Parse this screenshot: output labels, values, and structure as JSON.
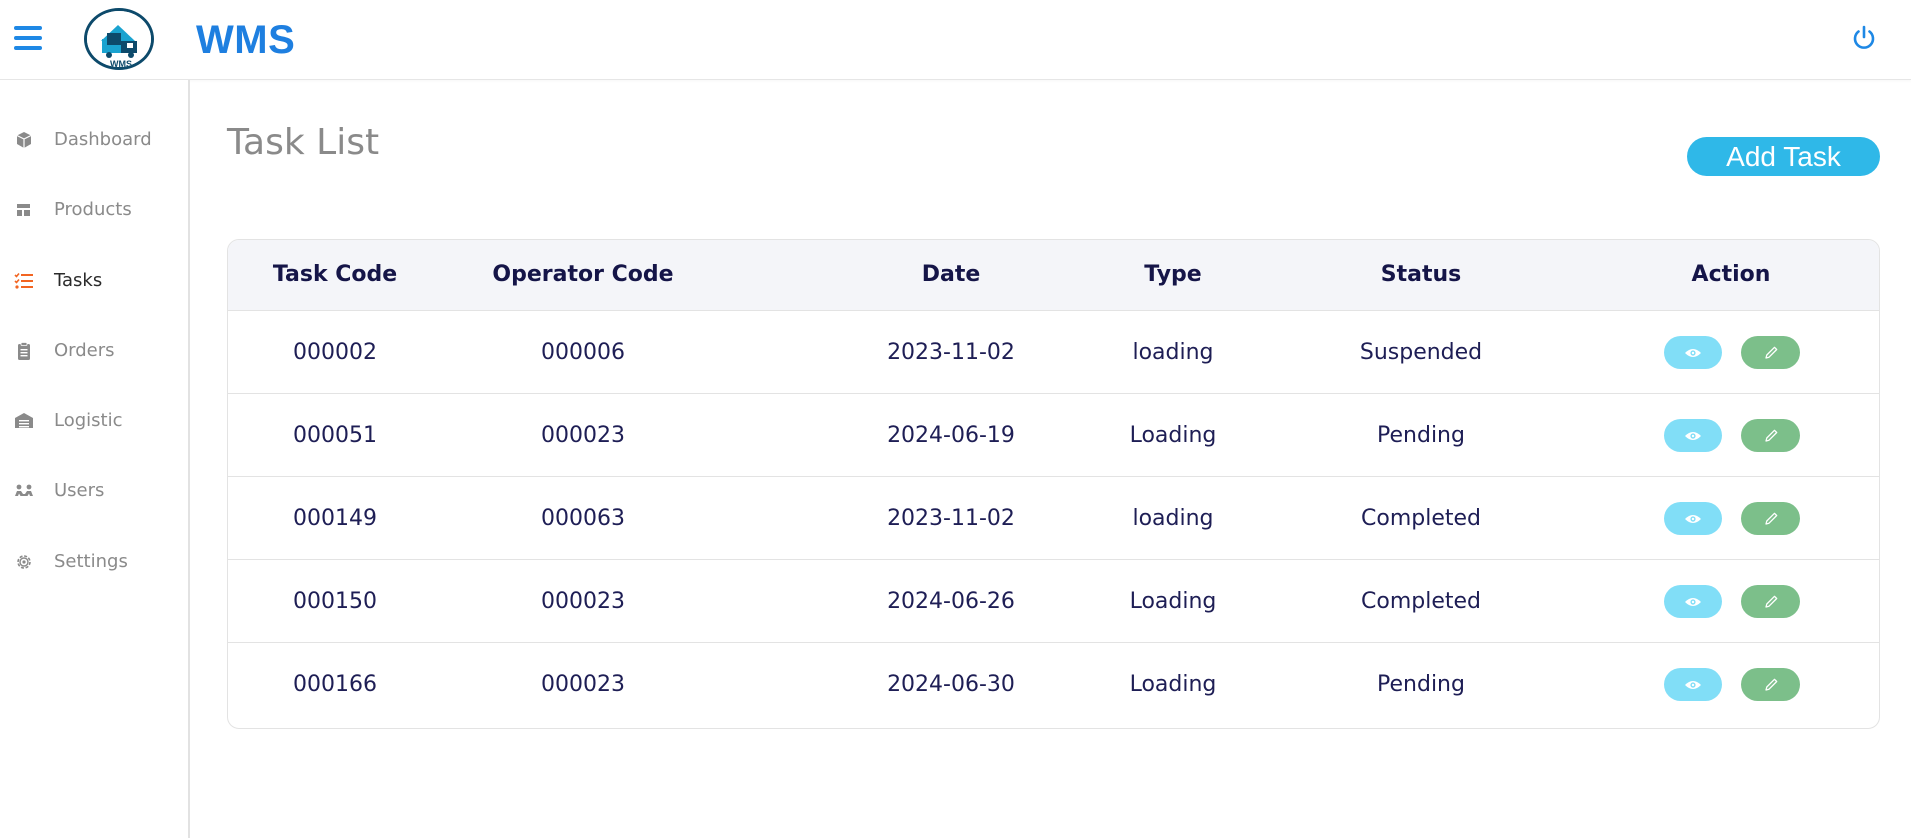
{
  "header": {
    "app_title": "WMS",
    "logo_text": "WMS",
    "menu_icon": "hamburger-icon",
    "power_icon": "power-icon",
    "accent_color": "#1e7fe0"
  },
  "sidebar": {
    "items": [
      {
        "label": "Dashboard",
        "icon": "box-icon",
        "active": false
      },
      {
        "label": "Products",
        "icon": "layout-icon",
        "active": false
      },
      {
        "label": "Tasks",
        "icon": "checklist-icon",
        "active": true
      },
      {
        "label": "Orders",
        "icon": "clipboard-icon",
        "active": false
      },
      {
        "label": "Logistic",
        "icon": "warehouse-icon",
        "active": false
      },
      {
        "label": "Users",
        "icon": "users-icon",
        "active": false
      },
      {
        "label": "Settings",
        "icon": "gear-icon",
        "active": false
      }
    ],
    "active_color": "#f26522"
  },
  "main": {
    "title": "Task List",
    "add_button_label": "Add Task",
    "add_button_color": "#2fb8e8"
  },
  "table": {
    "columns": [
      "Task Code",
      "Operator Code",
      "Date",
      "Type",
      "Status",
      "Action"
    ],
    "rows": [
      {
        "task_code": "000002",
        "operator_code": "000006",
        "date": "2023-11-02",
        "type": "loading",
        "status": "Suspended"
      },
      {
        "task_code": "000051",
        "operator_code": "000023",
        "date": "2024-06-19",
        "type": "Loading",
        "status": "Pending"
      },
      {
        "task_code": "000149",
        "operator_code": "000063",
        "date": "2023-11-02",
        "type": "loading",
        "status": "Completed"
      },
      {
        "task_code": "000150",
        "operator_code": "000023",
        "date": "2024-06-26",
        "type": "Loading",
        "status": "Completed"
      },
      {
        "task_code": "000166",
        "operator_code": "000023",
        "date": "2024-06-30",
        "type": "Loading",
        "status": "Pending"
      }
    ],
    "action_icons": {
      "view": "eye-icon",
      "edit": "pencil-icon"
    },
    "view_button_color": "#81def7",
    "edit_button_color": "#7cbf8a"
  }
}
